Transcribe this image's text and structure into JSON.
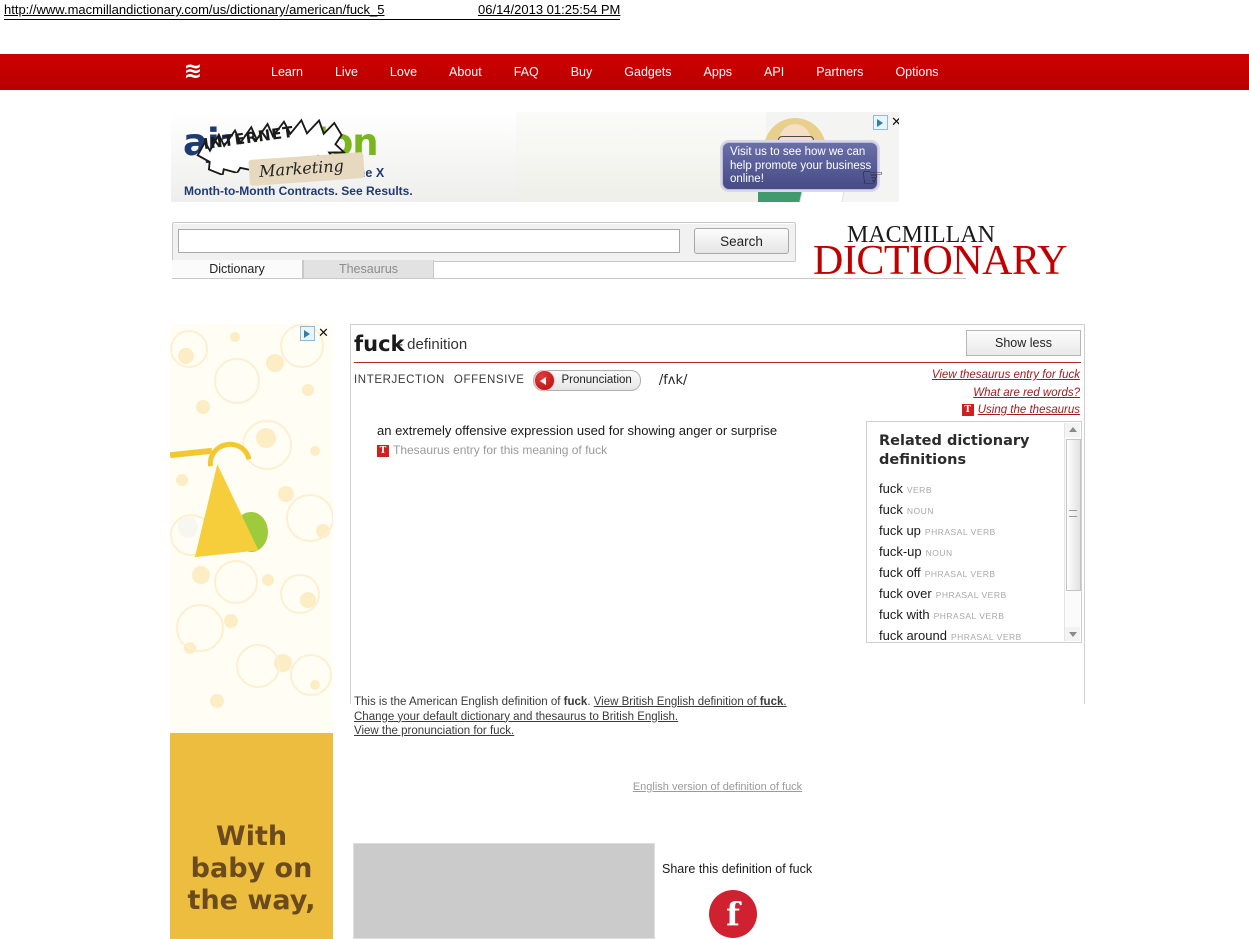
{
  "browser": {
    "url": "http://www.macmillandictionary.com/us/dictionary/american/fuck_5",
    "timestamp": "06/14/2013 01:25:54 PM"
  },
  "nav": {
    "logo_glyph": "≋",
    "items": [
      {
        "label": "Learn"
      },
      {
        "label": "Live"
      },
      {
        "label": "Love"
      },
      {
        "label": "About"
      },
      {
        "label": "FAQ"
      },
      {
        "label": "Buy"
      },
      {
        "label": "Gadgets"
      },
      {
        "label": "Apps"
      },
      {
        "label": "API"
      },
      {
        "label": "Partners"
      },
      {
        "label": "Options"
      }
    ]
  },
  "top_ad": {
    "brand_a": "aja",
    "brand_x": "x",
    "brand_union": "union",
    "tagline1": "It's All About The X",
    "tagline2": "Month-to-Month Contracts. See Results.",
    "burst": "INTERNET",
    "marketing": "Marketing",
    "cta": "Visit us to see how we can help promote your business online!",
    "close_glyph": "✕"
  },
  "search": {
    "value": "",
    "placeholder": "",
    "button_label": "Search",
    "tabs": [
      {
        "label": "Dictionary",
        "active": true
      },
      {
        "label": "Thesaurus",
        "active": false
      }
    ]
  },
  "logo": {
    "line1": "MACMILLAN",
    "line2": "DICTIONARY"
  },
  "side_ad": {
    "headline": "With\nbaby on\nthe way,",
    "close_glyph": "✕"
  },
  "entry": {
    "headword": "fuck",
    "headword_suffix": "- definition",
    "show_less_label": "Show less",
    "part_of_speech": "INTERJECTION",
    "register": "OFFENSIVE",
    "pronunciation_label": "Pronunciation",
    "ipa": "/fʌk/",
    "thesaurus_links": [
      {
        "text": "View thesaurus entry for fuck",
        "badge": false
      },
      {
        "text": "What are red words?",
        "badge": false
      },
      {
        "text": "Using the thesaurus",
        "badge": true
      }
    ],
    "badge_letter": "T",
    "senses": [
      {
        "definition": "an extremely offensive expression used for showing anger or surprise",
        "thesaurus_text": "Thesaurus entry for this meaning of fuck"
      }
    ]
  },
  "related": {
    "title": "Related dictionary definitions",
    "items": [
      {
        "word": "fuck",
        "pos": "VERB"
      },
      {
        "word": "fuck",
        "pos": "NOUN"
      },
      {
        "word": "fuck up",
        "pos": "PHRASAL VERB"
      },
      {
        "word": "fuck-up",
        "pos": "NOUN"
      },
      {
        "word": "fuck off",
        "pos": "PHRASAL VERB"
      },
      {
        "word": "fuck over",
        "pos": "PHRASAL VERB"
      },
      {
        "word": "fuck with",
        "pos": "PHRASAL VERB"
      },
      {
        "word": "fuck around",
        "pos": "PHRASAL VERB"
      }
    ]
  },
  "footer": {
    "line1_prefix": "This is the American English definition of ",
    "line1_word": "fuck",
    "line1_mid": ". ",
    "line1_link_a": "View British English definition of ",
    "line1_link_b": "fuck",
    "line1_link_c": ".",
    "line2": "Change your default dictionary and thesaurus to British English.",
    "line3": "View the pronunciation for fuck.",
    "english_version": "English version of definition of fuck",
    "share_label": "Share this definition of fuck",
    "facebook_glyph": "f"
  },
  "colors": {
    "brand_red": "#c00000",
    "link_red": "#a01c20",
    "badge_red": "#cf1f1f",
    "ad_yellow": "#edbd3f"
  }
}
